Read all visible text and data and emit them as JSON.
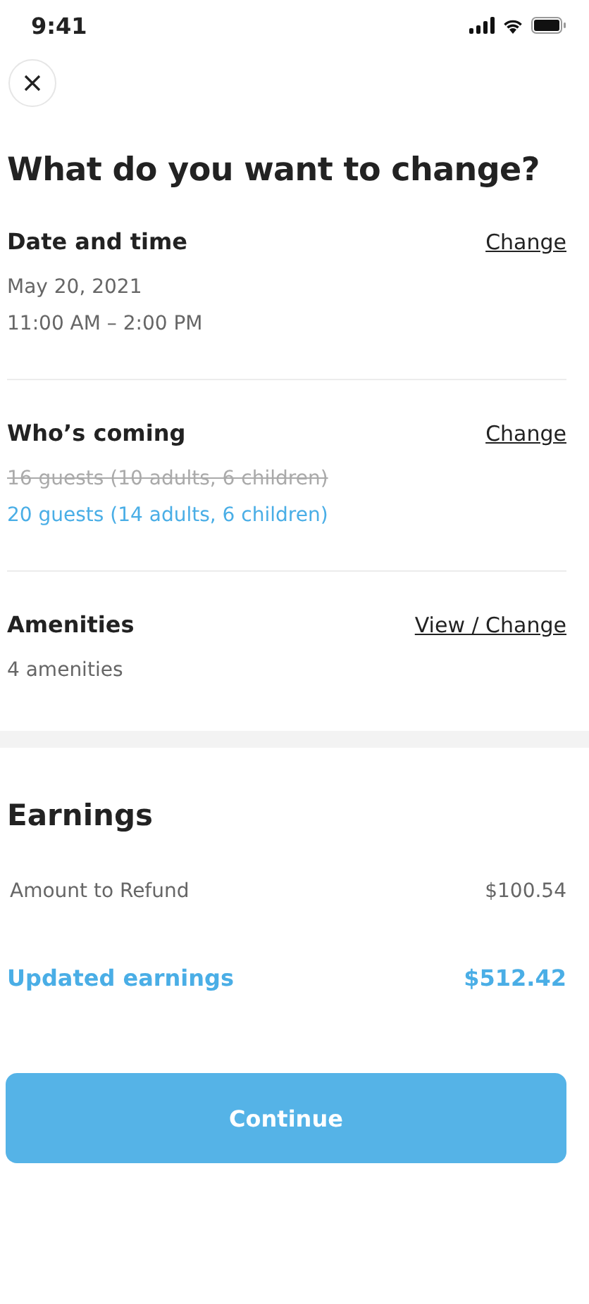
{
  "status_bar": {
    "time": "9:41"
  },
  "title": "What do you want to change?",
  "sections": [
    {
      "heading": "Date and time",
      "action": "Change",
      "lines": [
        {
          "text": "May 20, 2021",
          "kind": "plain"
        },
        {
          "text": "11:00 AM – 2:00 PM",
          "kind": "plain"
        }
      ]
    },
    {
      "heading": "Who’s coming",
      "action": "Change",
      "lines": [
        {
          "text": "16 guests (10 adults, 6 children)",
          "kind": "struck"
        },
        {
          "text": "20 guests (14 adults, 6 children)",
          "kind": "highlight"
        }
      ]
    },
    {
      "heading": "Amenities",
      "action": "View / Change",
      "lines": [
        {
          "text": "4 amenities",
          "kind": "plain"
        }
      ]
    }
  ],
  "earnings": {
    "heading": "Earnings",
    "rows": [
      {
        "label": "Amount to Refund",
        "value": "$100.54",
        "kind": "plain"
      },
      {
        "label": "Updated earnings",
        "value": "$512.42",
        "kind": "total"
      }
    ]
  },
  "button": "Continue"
}
